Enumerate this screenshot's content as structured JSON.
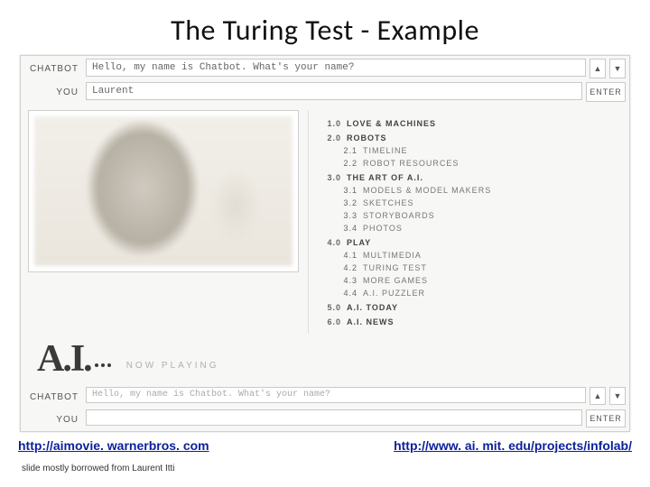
{
  "title": "The Turing Test - Example",
  "chat_top": {
    "labelBot": "CHATBOT",
    "botText": "Hello, my name is Chatbot.  What's your name?",
    "labelYou": "YOU",
    "youText": "Laurent",
    "enter": "ENTER",
    "upIcon": "▲",
    "downIcon": "▼"
  },
  "menu": [
    {
      "num": "1.0",
      "label": "LOVE & MACHINES",
      "sub": []
    },
    {
      "num": "2.0",
      "label": "ROBOTS",
      "sub": [
        {
          "num": "2.1",
          "label": "TIMELINE"
        },
        {
          "num": "2.2",
          "label": "ROBOT RESOURCES"
        }
      ]
    },
    {
      "num": "3.0",
      "label": "THE ART OF A.I.",
      "sub": [
        {
          "num": "3.1",
          "label": "MODELS & MODEL MAKERS"
        },
        {
          "num": "3.2",
          "label": "SKETCHES"
        },
        {
          "num": "3.3",
          "label": "STORYBOARDS"
        },
        {
          "num": "3.4",
          "label": "PHOTOS"
        }
      ]
    },
    {
      "num": "4.0",
      "label": "PLAY",
      "sub": [
        {
          "num": "4.1",
          "label": "MULTIMEDIA"
        },
        {
          "num": "4.2",
          "label": "TURING TEST"
        },
        {
          "num": "4.3",
          "label": "MORE GAMES"
        },
        {
          "num": "4.4",
          "label": "A.I. PUZZLER"
        }
      ]
    },
    {
      "num": "5.0",
      "label": "A.I. TODAY",
      "sub": []
    },
    {
      "num": "6.0",
      "label": "A.I. NEWS",
      "sub": []
    }
  ],
  "logo": {
    "text": "A.I.",
    "now": "NOW PLAYING"
  },
  "chat_bottom": {
    "labelBot": "CHATBOT",
    "botText": "Hello, my name is Chatbot.  What's your name?",
    "labelYou": "YOU",
    "youText": "",
    "enter": "ENTER",
    "upIcon": "▲",
    "downIcon": "▼"
  },
  "links": {
    "left": "http://aimovie. warnerbros. com",
    "right": "http://www. ai. mit. edu/projects/infolab/"
  },
  "credit": "slide mostly borrowed from Laurent Itti"
}
